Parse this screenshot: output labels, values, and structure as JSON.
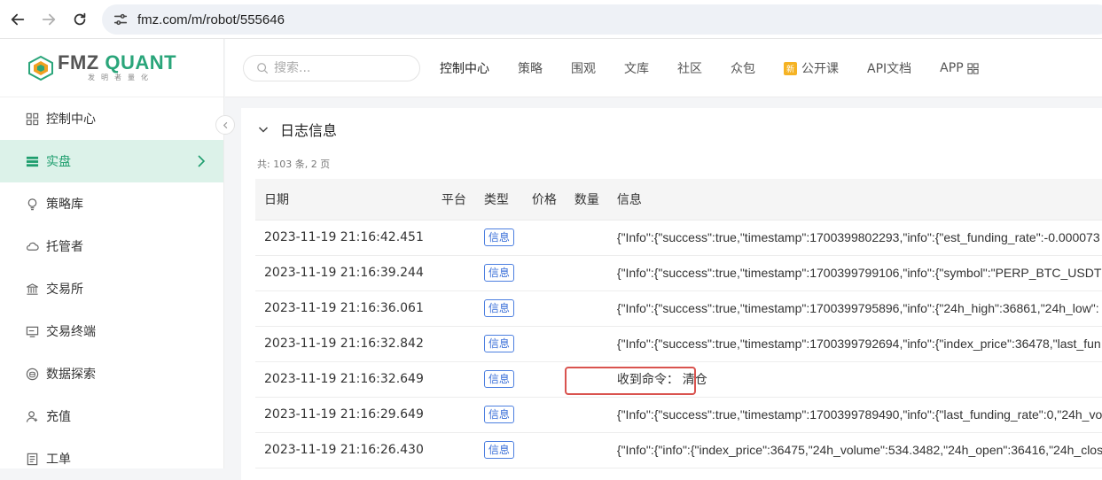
{
  "browser": {
    "url": "fmz.com/m/robot/555646"
  },
  "sidebar": {
    "logo_brand_a": "FMZ ",
    "logo_brand_b": "QUANT",
    "logo_tagline": "发明者量化",
    "items": [
      {
        "label": "控制中心",
        "icon": "grid-icon"
      },
      {
        "label": "实盘",
        "icon": "server-icon",
        "active": true
      },
      {
        "label": "策略库",
        "icon": "bulb-icon"
      },
      {
        "label": "托管者",
        "icon": "cloud-icon"
      },
      {
        "label": "交易所",
        "icon": "bank-icon"
      },
      {
        "label": "交易终端",
        "icon": "monitor-icon"
      },
      {
        "label": "数据探索",
        "icon": "database-icon"
      },
      {
        "label": "充值",
        "icon": "user-icon"
      },
      {
        "label": "工单",
        "icon": "ticket-icon"
      }
    ]
  },
  "topnav": {
    "search_placeholder": "搜索...",
    "links": [
      "控制中心",
      "策略",
      "围观",
      "文库",
      "社区",
      "众包",
      "公开课",
      "API文档",
      "APP"
    ],
    "new_badge": "新"
  },
  "log": {
    "title": "日志信息",
    "count": "共: 103 条, 2 页",
    "headers": [
      "日期",
      "平台",
      "类型",
      "价格",
      "数量",
      "信息"
    ],
    "rows": [
      {
        "date": "2023-11-19 21:16:42.451",
        "platform": "",
        "type": "信息",
        "price": "",
        "qty": "",
        "info": "{\"Info\":{\"success\":true,\"timestamp\":1700399802293,\"info\":{\"est_funding_rate\":-0.000073"
      },
      {
        "date": "2023-11-19 21:16:39.244",
        "platform": "",
        "type": "信息",
        "price": "",
        "qty": "",
        "info": "{\"Info\":{\"success\":true,\"timestamp\":1700399799106,\"info\":{\"symbol\":\"PERP_BTC_USDT\","
      },
      {
        "date": "2023-11-19 21:16:36.061",
        "platform": "",
        "type": "信息",
        "price": "",
        "qty": "",
        "info": "{\"Info\":{\"success\":true,\"timestamp\":1700399795896,\"info\":{\"24h_high\":36861,\"24h_low\":"
      },
      {
        "date": "2023-11-19 21:16:32.842",
        "platform": "",
        "type": "信息",
        "price": "",
        "qty": "",
        "info": "{\"Info\":{\"success\":true,\"timestamp\":1700399792694,\"info\":{\"index_price\":36478,\"last_fun"
      },
      {
        "date": "2023-11-19 21:16:32.649",
        "platform": "",
        "type": "信息",
        "price": "",
        "qty": "",
        "info": "收到命令： 清仓"
      },
      {
        "date": "2023-11-19 21:16:29.649",
        "platform": "",
        "type": "信息",
        "price": "",
        "qty": "",
        "info": "{\"Info\":{\"success\":true,\"timestamp\":1700399789490,\"info\":{\"last_funding_rate\":0,\"24h_vo"
      },
      {
        "date": "2023-11-19 21:16:26.430",
        "platform": "",
        "type": "信息",
        "price": "",
        "qty": "",
        "info": "{\"Info\":{\"info\":{\"index_price\":36475,\"24h_volume\":534.3482,\"24h_open\":36416,\"24h_clos"
      }
    ]
  },
  "colors": {
    "accent": "#1f9e6e",
    "active_bg": "#dcf2e9",
    "tag_blue": "#3a6fd8",
    "highlight": "#d9534f"
  }
}
